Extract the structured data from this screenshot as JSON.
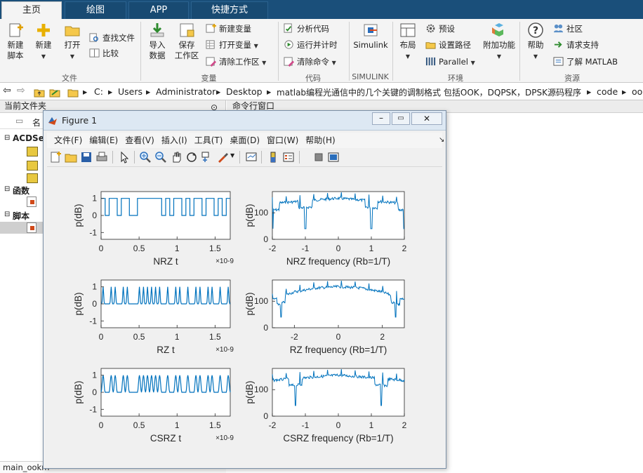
{
  "tabs": [
    "主页",
    "绘图",
    "APP",
    "快捷方式"
  ],
  "ribbon": {
    "file": {
      "new_script": "新建\n脚本",
      "new": "新建",
      "open": "打开",
      "find_files": "查找文件",
      "compare": "比较",
      "group": "文件"
    },
    "variable": {
      "import": "导入\n数据",
      "save_ws": "保存\n工作区",
      "new_var": "新建变量",
      "open_var": "打开变量",
      "clear_ws": "清除工作区",
      "group": "变量"
    },
    "code": {
      "analyze": "分析代码",
      "run_time": "运行并计时",
      "clear_cmd": "清除命令",
      "group": "代码"
    },
    "simulink": {
      "label": "Simulink",
      "group": "SIMULINK"
    },
    "env": {
      "layout": "布局",
      "prefs": "预设",
      "set_path": "设置路径",
      "parallel": "Parallel",
      "addons": "附加功能",
      "group": "环境"
    },
    "resources": {
      "help": "帮助",
      "community": "社区",
      "support": "请求支持",
      "learn": "了解 MATLAB",
      "group": "资源"
    }
  },
  "address": [
    "C:",
    "Users",
    "Administrator",
    "Desktop",
    "matlab编程光通信中的几个关键的调制格式 包括OOK，DQPSK，DPSK源码程序",
    "code",
    "oo"
  ],
  "left_panel": {
    "title": "当前文件夹",
    "col": "名",
    "sections": [
      "ACDSe",
      "函数",
      "脚本"
    ],
    "status": "main_ookm"
  },
  "right_panel": {
    "title": "命令行窗口"
  },
  "figure": {
    "title": "Figure 1",
    "menu": [
      "文件(F)",
      "编辑(E)",
      "查看(V)",
      "插入(I)",
      "工具(T)",
      "桌面(D)",
      "窗口(W)",
      "帮助(H)"
    ]
  },
  "chart_data": [
    {
      "type": "line",
      "title": "",
      "xlabel": "NRZ   t",
      "ylabel": "p(dB)",
      "xlim": [
        0,
        1.7e-09
      ],
      "ylim": [
        -1.4,
        1.4
      ],
      "xticks": [
        "0",
        "0.5",
        "1",
        "1.5"
      ],
      "yticks": [
        "1",
        "0",
        "-1"
      ],
      "exponent": "×10-9",
      "bits": [
        1,
        0,
        1,
        1,
        0,
        1,
        1,
        0,
        0,
        1,
        1,
        1,
        1,
        1,
        1,
        0,
        1,
        0,
        1,
        1,
        0,
        1,
        0,
        1,
        1,
        0,
        1,
        1,
        0,
        1,
        0,
        1
      ]
    },
    {
      "type": "line",
      "title": "",
      "xlabel": "NRZ   frequency (Rb=1/T)",
      "ylabel": "p(dB)",
      "xlim": [
        -2,
        2
      ],
      "ylim": [
        0,
        180
      ],
      "xticks": [
        "-2",
        "-1",
        "0",
        "1",
        "2"
      ],
      "yticks": [
        "100",
        "0"
      ],
      "nulls": [
        -2,
        -1,
        1,
        2
      ],
      "level": [
        140,
        150,
        160,
        150,
        140
      ]
    },
    {
      "type": "line",
      "title": "",
      "xlabel": "RZ   t",
      "ylabel": "p(dB)",
      "xlim": [
        0,
        1.7e-09
      ],
      "ylim": [
        -1.4,
        1.4
      ],
      "xticks": [
        "0",
        "0.5",
        "1",
        "1.5"
      ],
      "yticks": [
        "1",
        "0",
        "-1"
      ],
      "exponent": "×10-9",
      "bits": [
        1,
        0,
        1,
        1,
        0,
        1,
        1,
        0,
        0,
        1,
        1,
        1,
        1,
        1,
        1,
        0,
        1,
        0,
        1,
        1,
        0,
        1,
        0,
        1,
        1,
        0,
        1,
        1,
        0,
        1,
        0,
        1
      ]
    },
    {
      "type": "line",
      "title": "",
      "xlabel": "RZ   frequency (Rb=1/T)",
      "ylabel": "p(dB)",
      "xlim": [
        -3,
        3
      ],
      "ylim": [
        0,
        180
      ],
      "xticks": [
        "-2",
        "0",
        "2"
      ],
      "yticks": [
        "100",
        "0"
      ],
      "nulls": [
        -2.6,
        2.6
      ],
      "level": [
        110,
        140,
        155,
        160,
        155,
        140,
        110
      ]
    },
    {
      "type": "line",
      "title": "",
      "xlabel": "CSRZ   t",
      "ylabel": "p(dB)",
      "xlim": [
        0,
        1.7e-09
      ],
      "ylim": [
        -1.4,
        1.4
      ],
      "xticks": [
        "0",
        "0.5",
        "1",
        "1.5"
      ],
      "yticks": [
        "1",
        "0",
        "-1"
      ],
      "exponent": "×10-9",
      "bits": [
        1,
        0,
        1,
        1,
        0,
        1,
        1,
        0,
        0,
        1,
        1,
        1,
        1,
        1,
        1,
        0,
        1,
        0,
        1,
        1,
        0,
        1,
        0,
        1,
        1,
        0,
        1,
        1,
        0,
        1,
        0,
        1
      ]
    },
    {
      "type": "line",
      "title": "",
      "xlabel": "CSRZ   frequency (Rb=1/T)",
      "ylabel": "p(dB)",
      "xlim": [
        -2,
        2
      ],
      "ylim": [
        0,
        180
      ],
      "xticks": [
        "-2",
        "-1",
        "0",
        "1",
        "2"
      ],
      "yticks": [
        "100",
        "0"
      ],
      "nulls": [
        -1.3,
        1.3
      ],
      "level": [
        140,
        150,
        160,
        150,
        140
      ]
    }
  ],
  "colors": {
    "series": "#0072bd",
    "tabbar": "#1a4f7a"
  }
}
